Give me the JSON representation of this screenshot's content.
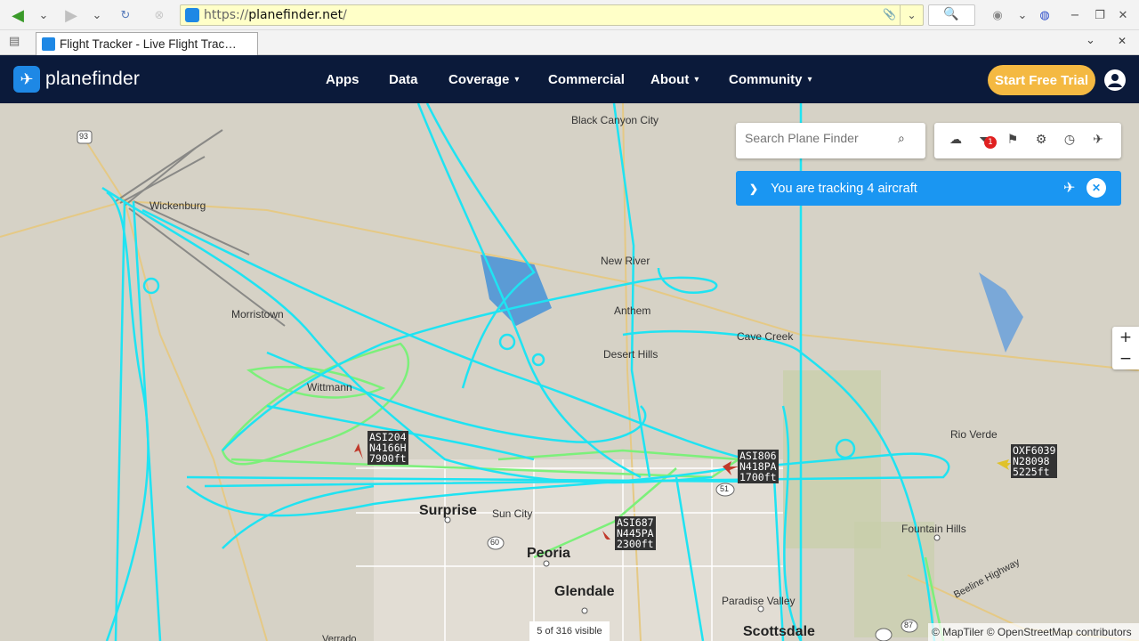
{
  "browser": {
    "url_scheme": "https://",
    "url_host": "planefinder.net",
    "url_path": "/",
    "tab_title": "Flight Tracker - Live Flight Trac…"
  },
  "nav": {
    "logo_text": "planefinder",
    "items": [
      "Apps",
      "Data",
      "Coverage",
      "Commercial",
      "About",
      "Community"
    ],
    "cta_label": "Start Free Trial"
  },
  "map_overlay": {
    "search_placeholder": "Search Plane Finder",
    "filter_badge": "1",
    "tracking_text": "You are tracking 4 aircraft",
    "zoom_in": "+",
    "zoom_out": "−",
    "visible_count": "5 of 316 visible",
    "attribution": "© MapTiler © OpenStreetMap contributors"
  },
  "places": {
    "black_canyon_city": "Black Canyon City",
    "wickenburg": "Wickenburg",
    "new_river": "New River",
    "morristown": "Morristown",
    "wittmann": "Wittmann",
    "anthem": "Anthem",
    "desert_hills": "Desert Hills",
    "cave_creek": "Cave Creek",
    "rio_verde": "Rio Verde",
    "surprise": "Surprise",
    "sun_city": "Sun City",
    "peoria": "Peoria",
    "glendale": "Glendale",
    "fountain_hills": "Fountain Hills",
    "paradise_valley": "Paradise Valley",
    "scottsdale": "Scottsdale",
    "verrado": "Verrado",
    "beeline_highway": "Beeline Highway",
    "route_93": "93",
    "route_51": "51",
    "route_60": "60",
    "route_87": "87"
  },
  "aircraft": [
    {
      "callsign": "ASI204",
      "reg": "N4166H",
      "alt": "7900ft"
    },
    {
      "callsign": "ASI806",
      "reg": "N418PA",
      "alt": "1700ft"
    },
    {
      "callsign": "ASI687",
      "reg": "N445PA",
      "alt": "2300ft"
    },
    {
      "callsign": "OXF6039",
      "reg": "N28098",
      "alt": "5225ft"
    }
  ],
  "colors": {
    "nav_bg": "#0b1a3a",
    "cta": "#f4b942",
    "track_cyan": "#1fe3f2",
    "track_green": "#7cf07a",
    "banner_blue": "#1a96f2"
  }
}
